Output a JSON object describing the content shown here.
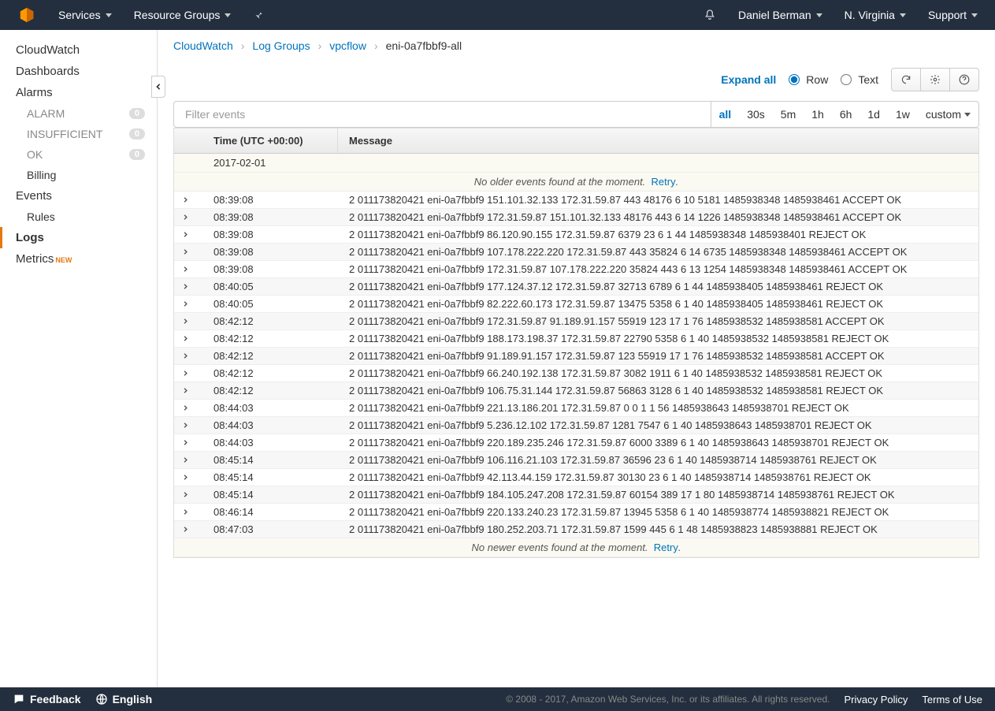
{
  "topnav": {
    "services": "Services",
    "resource_groups": "Resource Groups",
    "user": "Daniel Berman",
    "region": "N. Virginia",
    "support": "Support"
  },
  "sidebar": {
    "items": [
      {
        "label": "CloudWatch",
        "type": "main"
      },
      {
        "label": "Dashboards",
        "type": "main"
      },
      {
        "label": "Alarms",
        "type": "main"
      },
      {
        "label": "ALARM",
        "type": "sub",
        "badge": "0"
      },
      {
        "label": "INSUFFICIENT",
        "type": "sub",
        "badge": "0"
      },
      {
        "label": "OK",
        "type": "sub",
        "badge": "0"
      },
      {
        "label": "Billing",
        "type": "sub",
        "enabled": true
      },
      {
        "label": "Events",
        "type": "main"
      },
      {
        "label": "Rules",
        "type": "sub",
        "enabled": true
      },
      {
        "label": "Logs",
        "type": "main",
        "active": true
      },
      {
        "label": "Metrics",
        "type": "main",
        "new": true
      }
    ]
  },
  "breadcrumb": {
    "items": [
      "CloudWatch",
      "Log Groups",
      "vpcflow"
    ],
    "current": "eni-0a7fbbf9-all"
  },
  "toolbar": {
    "expand_all": "Expand all",
    "row_label": "Row",
    "text_label": "Text"
  },
  "filter": {
    "placeholder": "Filter events",
    "ranges": [
      "all",
      "30s",
      "5m",
      "1h",
      "6h",
      "1d",
      "1w",
      "custom"
    ]
  },
  "table": {
    "col_time": "Time (UTC +00:00)",
    "col_msg": "Message",
    "date": "2017-02-01",
    "no_older": "No older events found at the moment.",
    "no_newer": "No newer events found at the moment.",
    "retry": "Retry",
    "rows": [
      {
        "t": "08:39:08",
        "m": "2 011173820421 eni-0a7fbbf9 151.101.32.133 172.31.59.87 443 48176 6 10 5181 1485938348 1485938461 ACCEPT OK"
      },
      {
        "t": "08:39:08",
        "m": "2 011173820421 eni-0a7fbbf9 172.31.59.87 151.101.32.133 48176 443 6 14 1226 1485938348 1485938461 ACCEPT OK"
      },
      {
        "t": "08:39:08",
        "m": "2 011173820421 eni-0a7fbbf9 86.120.90.155 172.31.59.87 6379 23 6 1 44 1485938348 1485938401 REJECT OK"
      },
      {
        "t": "08:39:08",
        "m": "2 011173820421 eni-0a7fbbf9 107.178.222.220 172.31.59.87 443 35824 6 14 6735 1485938348 1485938461 ACCEPT OK"
      },
      {
        "t": "08:39:08",
        "m": "2 011173820421 eni-0a7fbbf9 172.31.59.87 107.178.222.220 35824 443 6 13 1254 1485938348 1485938461 ACCEPT OK"
      },
      {
        "t": "08:40:05",
        "m": "2 011173820421 eni-0a7fbbf9 177.124.37.12 172.31.59.87 32713 6789 6 1 44 1485938405 1485938461 REJECT OK"
      },
      {
        "t": "08:40:05",
        "m": "2 011173820421 eni-0a7fbbf9 82.222.60.173 172.31.59.87 13475 5358 6 1 40 1485938405 1485938461 REJECT OK"
      },
      {
        "t": "08:42:12",
        "m": "2 011173820421 eni-0a7fbbf9 172.31.59.87 91.189.91.157 55919 123 17 1 76 1485938532 1485938581 ACCEPT OK"
      },
      {
        "t": "08:42:12",
        "m": "2 011173820421 eni-0a7fbbf9 188.173.198.37 172.31.59.87 22790 5358 6 1 40 1485938532 1485938581 REJECT OK"
      },
      {
        "t": "08:42:12",
        "m": "2 011173820421 eni-0a7fbbf9 91.189.91.157 172.31.59.87 123 55919 17 1 76 1485938532 1485938581 ACCEPT OK"
      },
      {
        "t": "08:42:12",
        "m": "2 011173820421 eni-0a7fbbf9 66.240.192.138 172.31.59.87 3082 1911 6 1 40 1485938532 1485938581 REJECT OK"
      },
      {
        "t": "08:42:12",
        "m": "2 011173820421 eni-0a7fbbf9 106.75.31.144 172.31.59.87 56863 3128 6 1 40 1485938532 1485938581 REJECT OK"
      },
      {
        "t": "08:44:03",
        "m": "2 011173820421 eni-0a7fbbf9 221.13.186.201 172.31.59.87 0 0 1 1 56 1485938643 1485938701 REJECT OK"
      },
      {
        "t": "08:44:03",
        "m": "2 011173820421 eni-0a7fbbf9 5.236.12.102 172.31.59.87 1281 7547 6 1 40 1485938643 1485938701 REJECT OK"
      },
      {
        "t": "08:44:03",
        "m": "2 011173820421 eni-0a7fbbf9 220.189.235.246 172.31.59.87 6000 3389 6 1 40 1485938643 1485938701 REJECT OK"
      },
      {
        "t": "08:45:14",
        "m": "2 011173820421 eni-0a7fbbf9 106.116.21.103 172.31.59.87 36596 23 6 1 40 1485938714 1485938761 REJECT OK"
      },
      {
        "t": "08:45:14",
        "m": "2 011173820421 eni-0a7fbbf9 42.113.44.159 172.31.59.87 30130 23 6 1 40 1485938714 1485938761 REJECT OK"
      },
      {
        "t": "08:45:14",
        "m": "2 011173820421 eni-0a7fbbf9 184.105.247.208 172.31.59.87 60154 389 17 1 80 1485938714 1485938761 REJECT OK"
      },
      {
        "t": "08:46:14",
        "m": "2 011173820421 eni-0a7fbbf9 220.133.240.23 172.31.59.87 13945 5358 6 1 40 1485938774 1485938821 REJECT OK"
      },
      {
        "t": "08:47:03",
        "m": "2 011173820421 eni-0a7fbbf9 180.252.203.71 172.31.59.87 1599 445 6 1 48 1485938823 1485938881 REJECT OK"
      }
    ]
  },
  "footer": {
    "feedback": "Feedback",
    "language": "English",
    "copyright": "© 2008 - 2017, Amazon Web Services, Inc. or its affiliates. All rights reserved.",
    "privacy": "Privacy Policy",
    "terms": "Terms of Use"
  }
}
